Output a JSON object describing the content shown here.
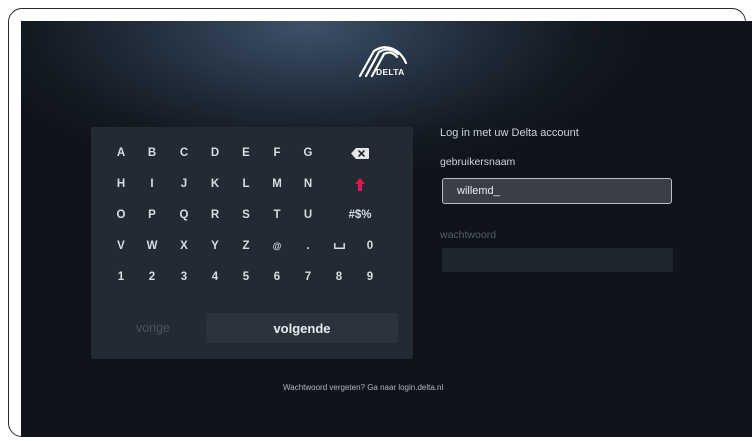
{
  "brand": {
    "logo_text": "DELTA",
    "accent_color": "#e0174e"
  },
  "keyboard": {
    "rows": [
      [
        "A",
        "B",
        "C",
        "D",
        "E",
        "F",
        "G"
      ],
      [
        "H",
        "I",
        "J",
        "K",
        "L",
        "M",
        "N"
      ],
      [
        "O",
        "P",
        "Q",
        "R",
        "S",
        "T",
        "U"
      ],
      [
        "V",
        "W",
        "X",
        "Y",
        "Z",
        "@",
        ".",
        "",
        ""
      ],
      [
        "1",
        "2",
        "3",
        "4",
        "5",
        "6",
        "7",
        "8",
        "9"
      ]
    ],
    "special": {
      "symbols": "#$%",
      "zero": "0",
      "backspace_icon": "backspace-icon",
      "shift_icon": "shift-arrow-icon",
      "space_icon": "space-icon"
    },
    "prev_label": "vorige",
    "next_label": "volgende"
  },
  "form": {
    "title": "Log in met uw Delta account",
    "username_label": "gebruikersnaam",
    "username_value": "willemd_",
    "password_label": "wachtwoord",
    "password_value": ""
  },
  "footer": {
    "text": "Wachtwoord vergeten? Ga naar login.delta.nl"
  }
}
